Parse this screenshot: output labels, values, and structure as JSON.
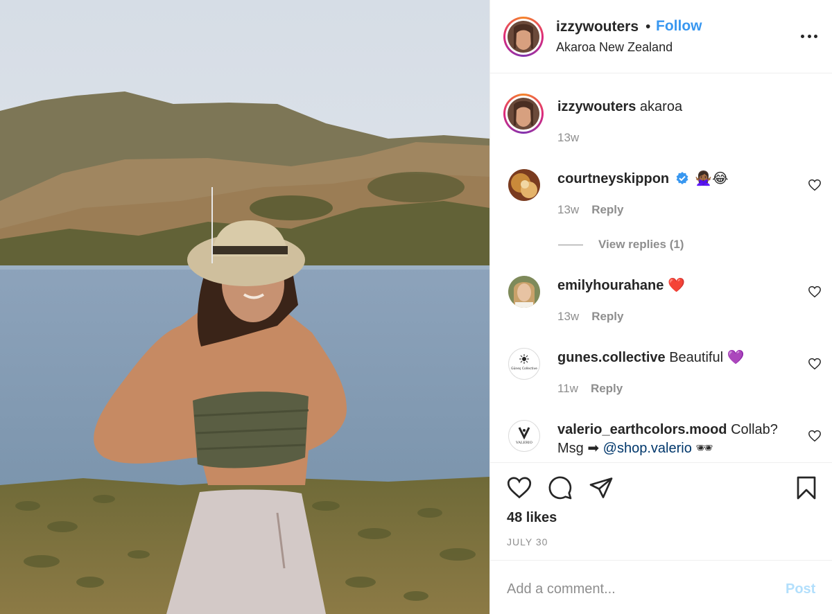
{
  "header": {
    "username": "izzywouters",
    "separator": "•",
    "follow_label": "Follow",
    "location": "Akaroa New Zealand",
    "more_icon": "more-horizontal-icon"
  },
  "caption": {
    "username": "izzywouters",
    "text": "akaroa",
    "time": "13w"
  },
  "comments": [
    {
      "username": "courtneyskippon",
      "verified": true,
      "text": "🙅🏾‍♀️😂",
      "time": "13w",
      "reply_label": "Reply"
    },
    {
      "username": "emilyhourahane",
      "text": "❤️",
      "time": "13w",
      "reply_label": "Reply"
    },
    {
      "username": "gunes.collective",
      "text": "Beautiful 💜",
      "time": "11w",
      "reply_label": "Reply"
    },
    {
      "username": "valerio_earthcolors.mood",
      "text": "Collab? Msg ➡",
      "mention": "@shop.valerio",
      "text_after": " 🕶"
    }
  ],
  "view_replies_label": "View replies (1)",
  "avatar_labels": {
    "gunes": "Güneş Collective",
    "valerio": "VALERIO"
  },
  "actions": {
    "likes": "48 likes",
    "date": "JULY 30"
  },
  "add_comment": {
    "placeholder": "Add a comment...",
    "post_label": "Post"
  },
  "colors": {
    "link_blue": "#3897f0",
    "text": "#262626",
    "muted": "#8e8e8e",
    "post_disabled": "#b2dffc",
    "verified": "#3897f0",
    "heart_red": "#ed4956"
  }
}
